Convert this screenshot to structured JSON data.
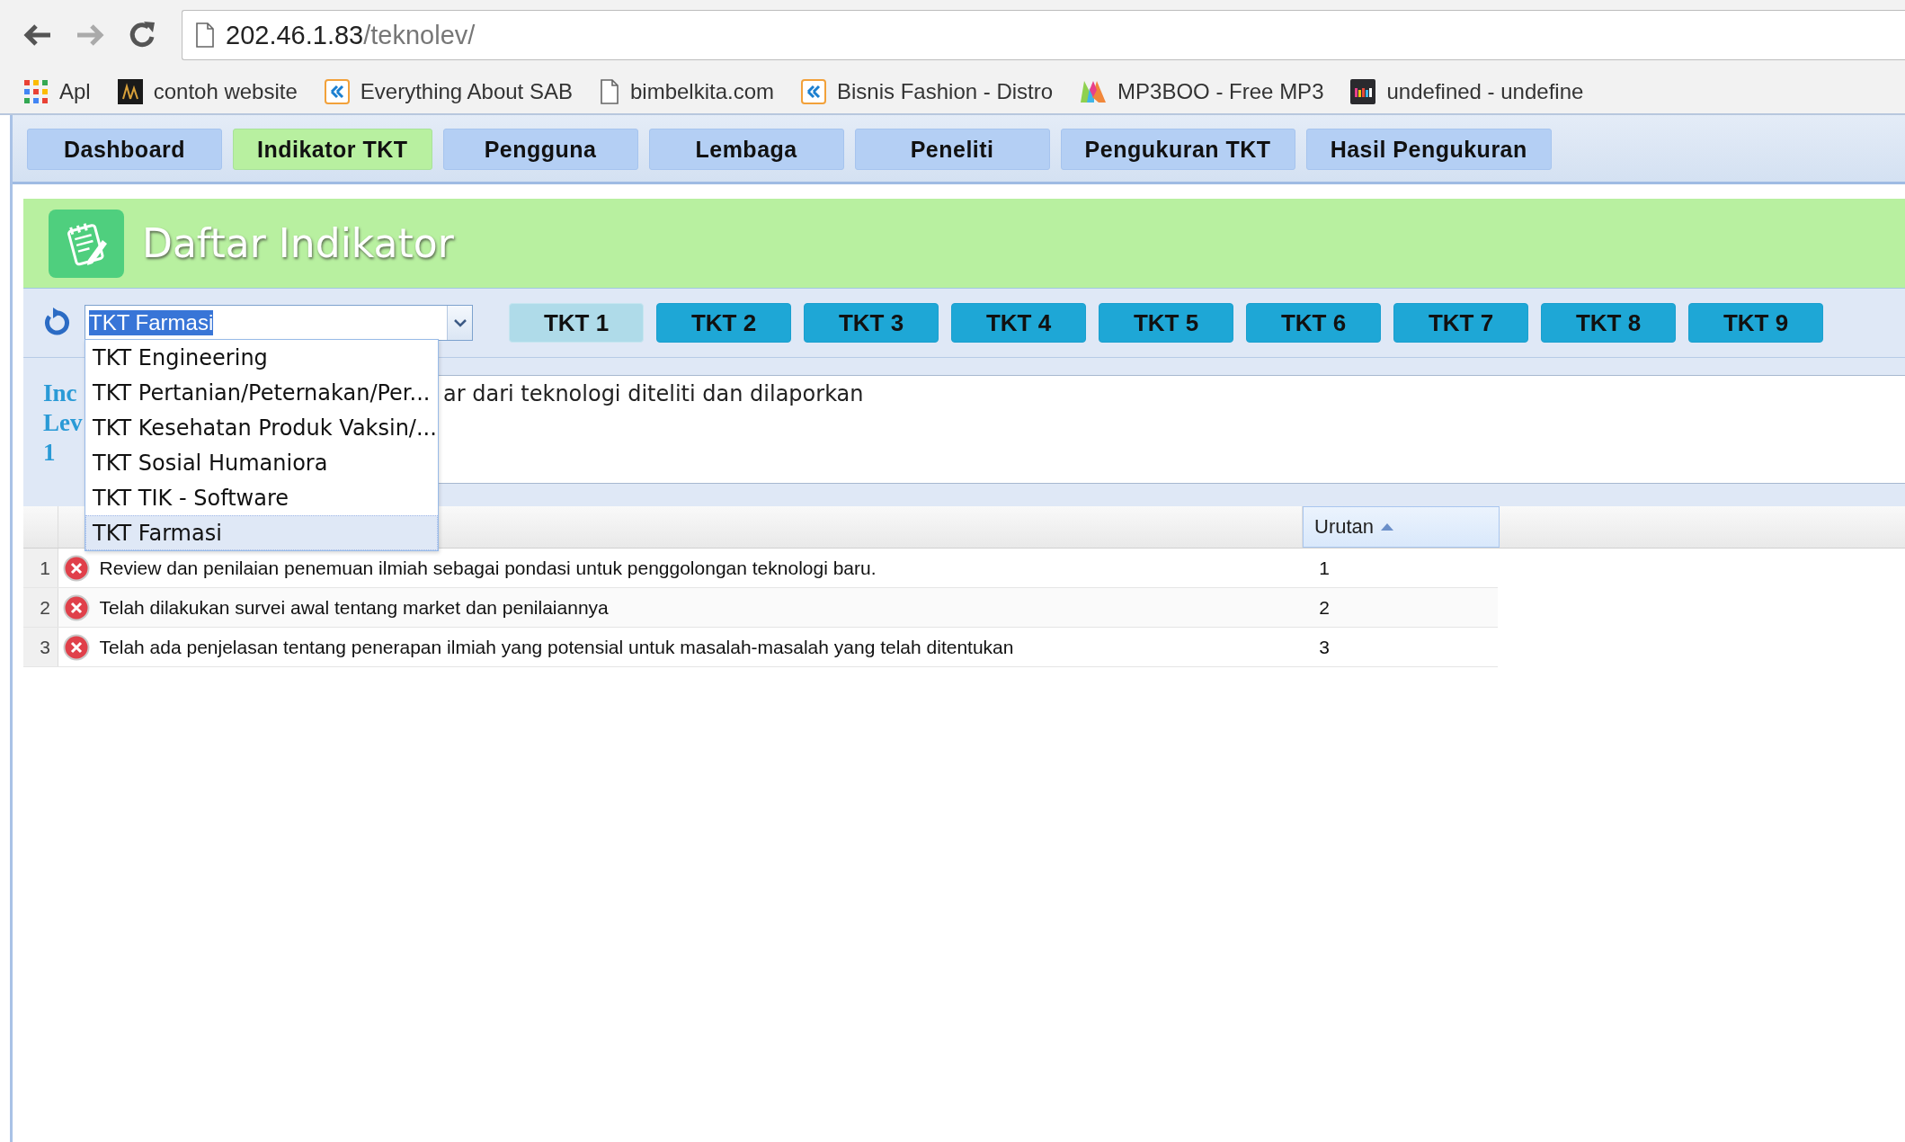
{
  "browser": {
    "url_host": "202.46.1.83",
    "url_path": "/teknolev/",
    "bookmarks": [
      {
        "label": "Apl",
        "kind": "apps"
      },
      {
        "label": "contoh website",
        "kind": "dark"
      },
      {
        "label": "Everything About SAB",
        "kind": "k"
      },
      {
        "label": "bimbelkita.com",
        "kind": "page"
      },
      {
        "label": "Bisnis Fashion - Distro",
        "kind": "k"
      },
      {
        "label": "MP3BOO - Free MP3",
        "kind": "m"
      },
      {
        "label": "undefined - undefine",
        "kind": "bars"
      }
    ]
  },
  "nav": [
    {
      "label": "Dashboard",
      "selected": false
    },
    {
      "label": "Indikator TKT",
      "selected": true
    },
    {
      "label": "Pengguna",
      "selected": false
    },
    {
      "label": "Lembaga",
      "selected": false
    },
    {
      "label": "Peneliti",
      "selected": false
    },
    {
      "label": "Pengukuran TKT",
      "selected": false
    },
    {
      "label": "Hasil Pengukuran",
      "selected": false
    }
  ],
  "header": {
    "title": "Daftar Indikator"
  },
  "toolbar": {
    "combo_value": "TKT Farmasi",
    "text_selected": true,
    "levels": [
      {
        "label": "TKT 1",
        "selected": true
      },
      {
        "label": "TKT 2",
        "selected": false
      },
      {
        "label": "TKT 3",
        "selected": false
      },
      {
        "label": "TKT 4",
        "selected": false
      },
      {
        "label": "TKT 5",
        "selected": false
      },
      {
        "label": "TKT 6",
        "selected": false
      },
      {
        "label": "TKT 7",
        "selected": false
      },
      {
        "label": "TKT 8",
        "selected": false
      },
      {
        "label": "TKT 9",
        "selected": false
      }
    ]
  },
  "dropdown": {
    "options": [
      {
        "label": "TKT Engineering",
        "selected": false
      },
      {
        "label": "TKT Pertanian/Peternakan/Per...",
        "selected": false
      },
      {
        "label": "TKT Kesehatan Produk Vaksin/...",
        "selected": false
      },
      {
        "label": "TKT Sosial Humaniora",
        "selected": false
      },
      {
        "label": "TKT TIK - Software",
        "selected": false
      },
      {
        "label": "TKT Farmasi",
        "selected": true
      }
    ]
  },
  "info": {
    "label_lines": [
      "Inc",
      "Lev",
      "1"
    ],
    "text": "ar dari teknologi diteliti dan dilaporkan"
  },
  "table": {
    "columns": [
      {
        "label": "Urutan",
        "sorted": true
      }
    ],
    "rows": [
      {
        "no": "1",
        "description": "Review dan penilaian penemuan ilmiah sebagai pondasi untuk penggolongan teknologi baru.",
        "order": "1"
      },
      {
        "no": "2",
        "description": "Telah dilakukan survei awal tentang market dan penilaiannya",
        "order": "2"
      },
      {
        "no": "3",
        "description": "Telah ada penjelasan tentang penerapan ilmiah yang potensial untuk masalah-masalah yang telah ditentukan",
        "order": "3"
      }
    ]
  }
}
